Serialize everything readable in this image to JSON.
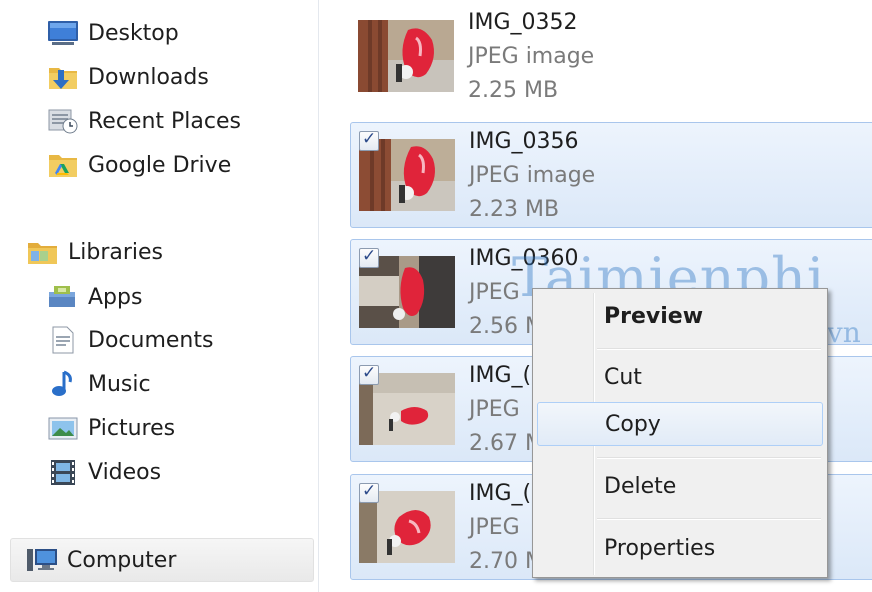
{
  "nav": {
    "favorites": [
      {
        "label": "Desktop",
        "icon": "desktop-icon"
      },
      {
        "label": "Downloads",
        "icon": "downloads-icon"
      },
      {
        "label": "Recent Places",
        "icon": "recent-places-icon"
      },
      {
        "label": "Google Drive",
        "icon": "google-drive-icon"
      }
    ],
    "libraries": {
      "label": "Libraries",
      "icon": "libraries-icon"
    },
    "library_items": [
      {
        "label": "Apps",
        "icon": "apps-icon"
      },
      {
        "label": "Documents",
        "icon": "documents-icon"
      },
      {
        "label": "Music",
        "icon": "music-icon"
      },
      {
        "label": "Pictures",
        "icon": "pictures-icon"
      },
      {
        "label": "Videos",
        "icon": "videos-icon"
      }
    ],
    "computer": {
      "label": "Computer",
      "icon": "computer-icon"
    }
  },
  "files": [
    {
      "name": "IMG_0352",
      "type": "JPEG image",
      "size": "2.25 MB",
      "selected": false
    },
    {
      "name": "IMG_0356",
      "type": "JPEG image",
      "size": "2.23 MB",
      "selected": true
    },
    {
      "name": "IMG_0360",
      "type": "JPEG",
      "size": "2.56 M",
      "selected": true
    },
    {
      "name": "IMG_(",
      "type": "JPEG",
      "size": "2.67 M",
      "selected": true
    },
    {
      "name": "IMG_(",
      "type": "JPEG",
      "size": "2.70 M",
      "selected": true
    }
  ],
  "watermark": {
    "main": "Taimienphi",
    "sub": ".vn"
  },
  "context_menu": {
    "items": [
      {
        "label": "Preview",
        "bold": true
      },
      {
        "label": "Cut"
      },
      {
        "label": "Copy",
        "hover": true
      },
      {
        "label": "Delete"
      },
      {
        "label": "Properties"
      }
    ]
  }
}
